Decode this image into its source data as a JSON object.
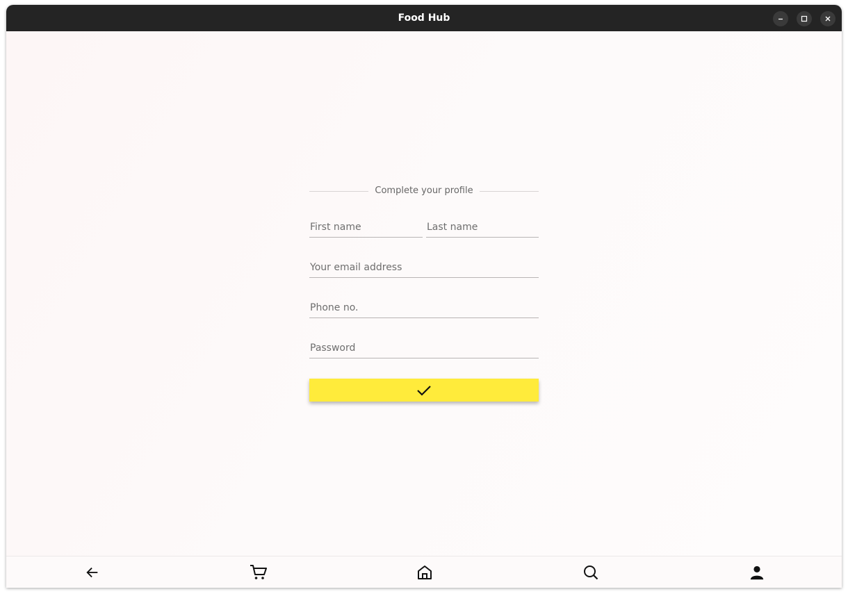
{
  "window": {
    "title": "Food Hub",
    "controls": [
      "minimize-icon",
      "maximize-icon",
      "close-icon"
    ]
  },
  "form": {
    "heading": "Complete your profile",
    "first_name_placeholder": "First name",
    "last_name_placeholder": "Last name",
    "email_placeholder": "Your email address",
    "phone_placeholder": "Phone no.",
    "password_placeholder": "Password",
    "submit_icon": "check-icon"
  },
  "bottom_nav": {
    "items": [
      "back-arrow-icon",
      "cart-icon",
      "home-icon",
      "search-icon",
      "account-icon"
    ]
  },
  "colors": {
    "titlebar": "#242424",
    "accent": "#ffeb3b",
    "background": "#fdf8f8"
  }
}
